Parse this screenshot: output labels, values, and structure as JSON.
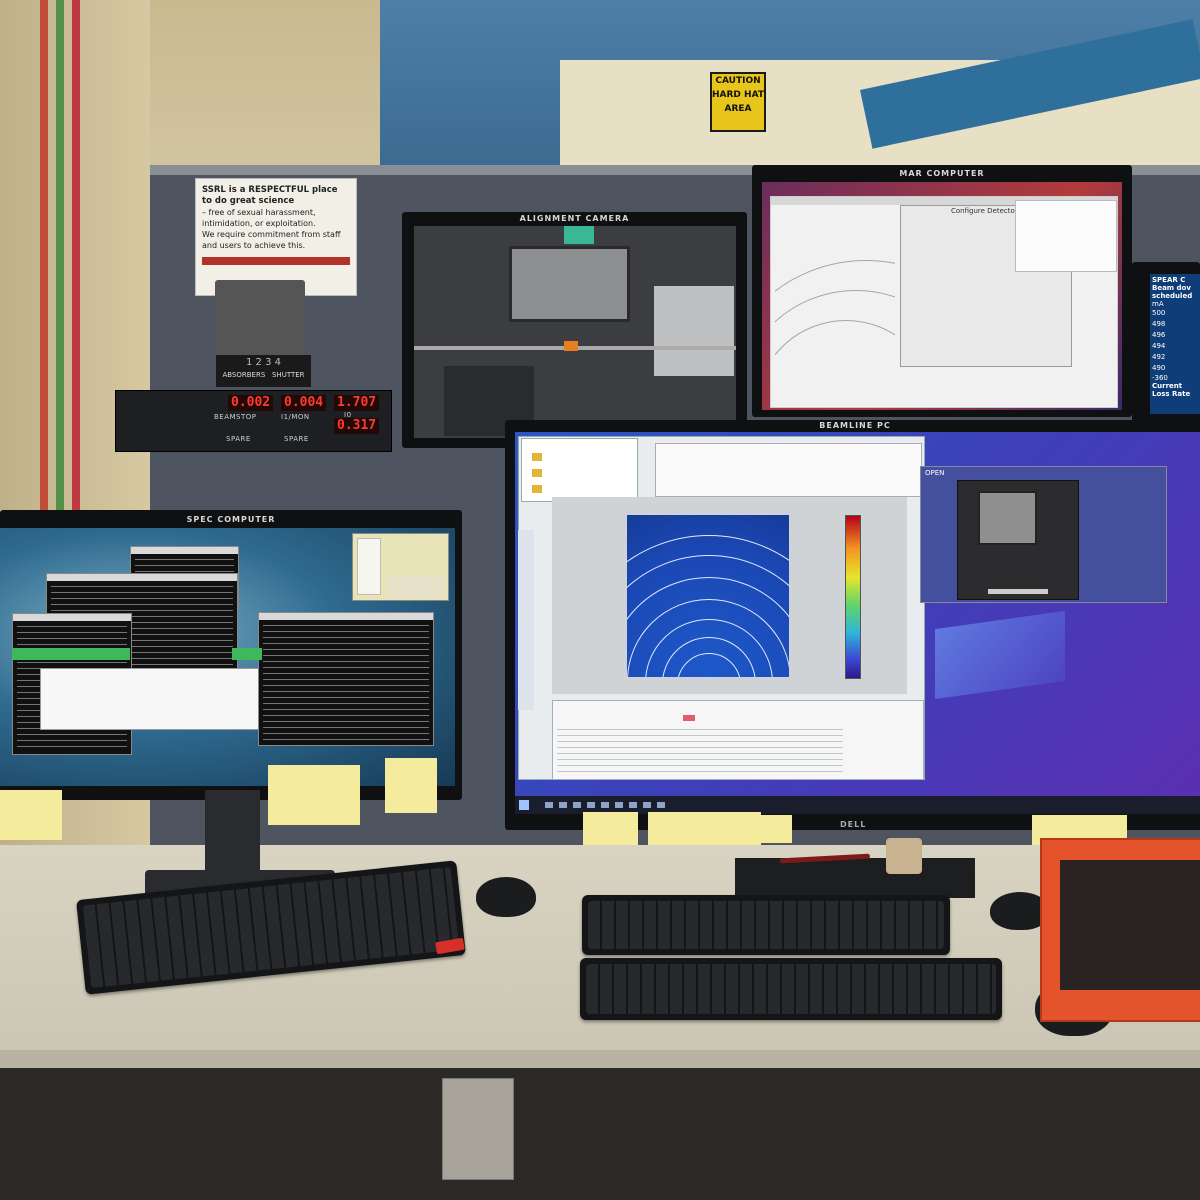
{
  "scene": {
    "caution_sign": {
      "line1": "CAUTION",
      "line2": "HARD HAT",
      "line3": "AREA"
    },
    "poster": {
      "title": "SSRL is a RESPECTFUL place to do great science",
      "line2": "– free of sexual harassment, intimidation, or exploitation.",
      "line3": "We require commitment from staff and users to achieve this."
    },
    "instrument_panel": {
      "absorbers_label": "ABSORBERS",
      "shutter_label": "SHUTTER",
      "absorber_digits": "1 2 3 4",
      "beamstop_label": "BEAMSTOP",
      "i1_mon_label": "I1/MON",
      "i0_label": "I0",
      "spare_left_label": "SPARE",
      "spare_right_label": "SPARE",
      "beamstop_value": "0.002",
      "i1_mon_value": "0.004",
      "i0_value": "1.707",
      "lower_value": "0.317"
    },
    "monitors": {
      "alignment_camera": {
        "label": "ALIGNMENT CAMERA"
      },
      "mar_computer": {
        "label": "MAR COMPUTER",
        "dialog_title": "Configure Detector"
      },
      "spear": {
        "label": "SPEAR C",
        "line1": "Beam dov",
        "line2": "scheduled",
        "unit": "mA",
        "ticks": [
          "500",
          "498",
          "496",
          "494",
          "492",
          "490"
        ],
        "x_tick": "-360",
        "footer1": "Current",
        "footer2": "Loss Rate"
      },
      "spec_computer": {
        "label": "SPEC COMPUTER"
      },
      "beamline_pc": {
        "label": "BEAMLINE PC",
        "brand": "DELL",
        "open_app": "OPEN"
      }
    }
  }
}
